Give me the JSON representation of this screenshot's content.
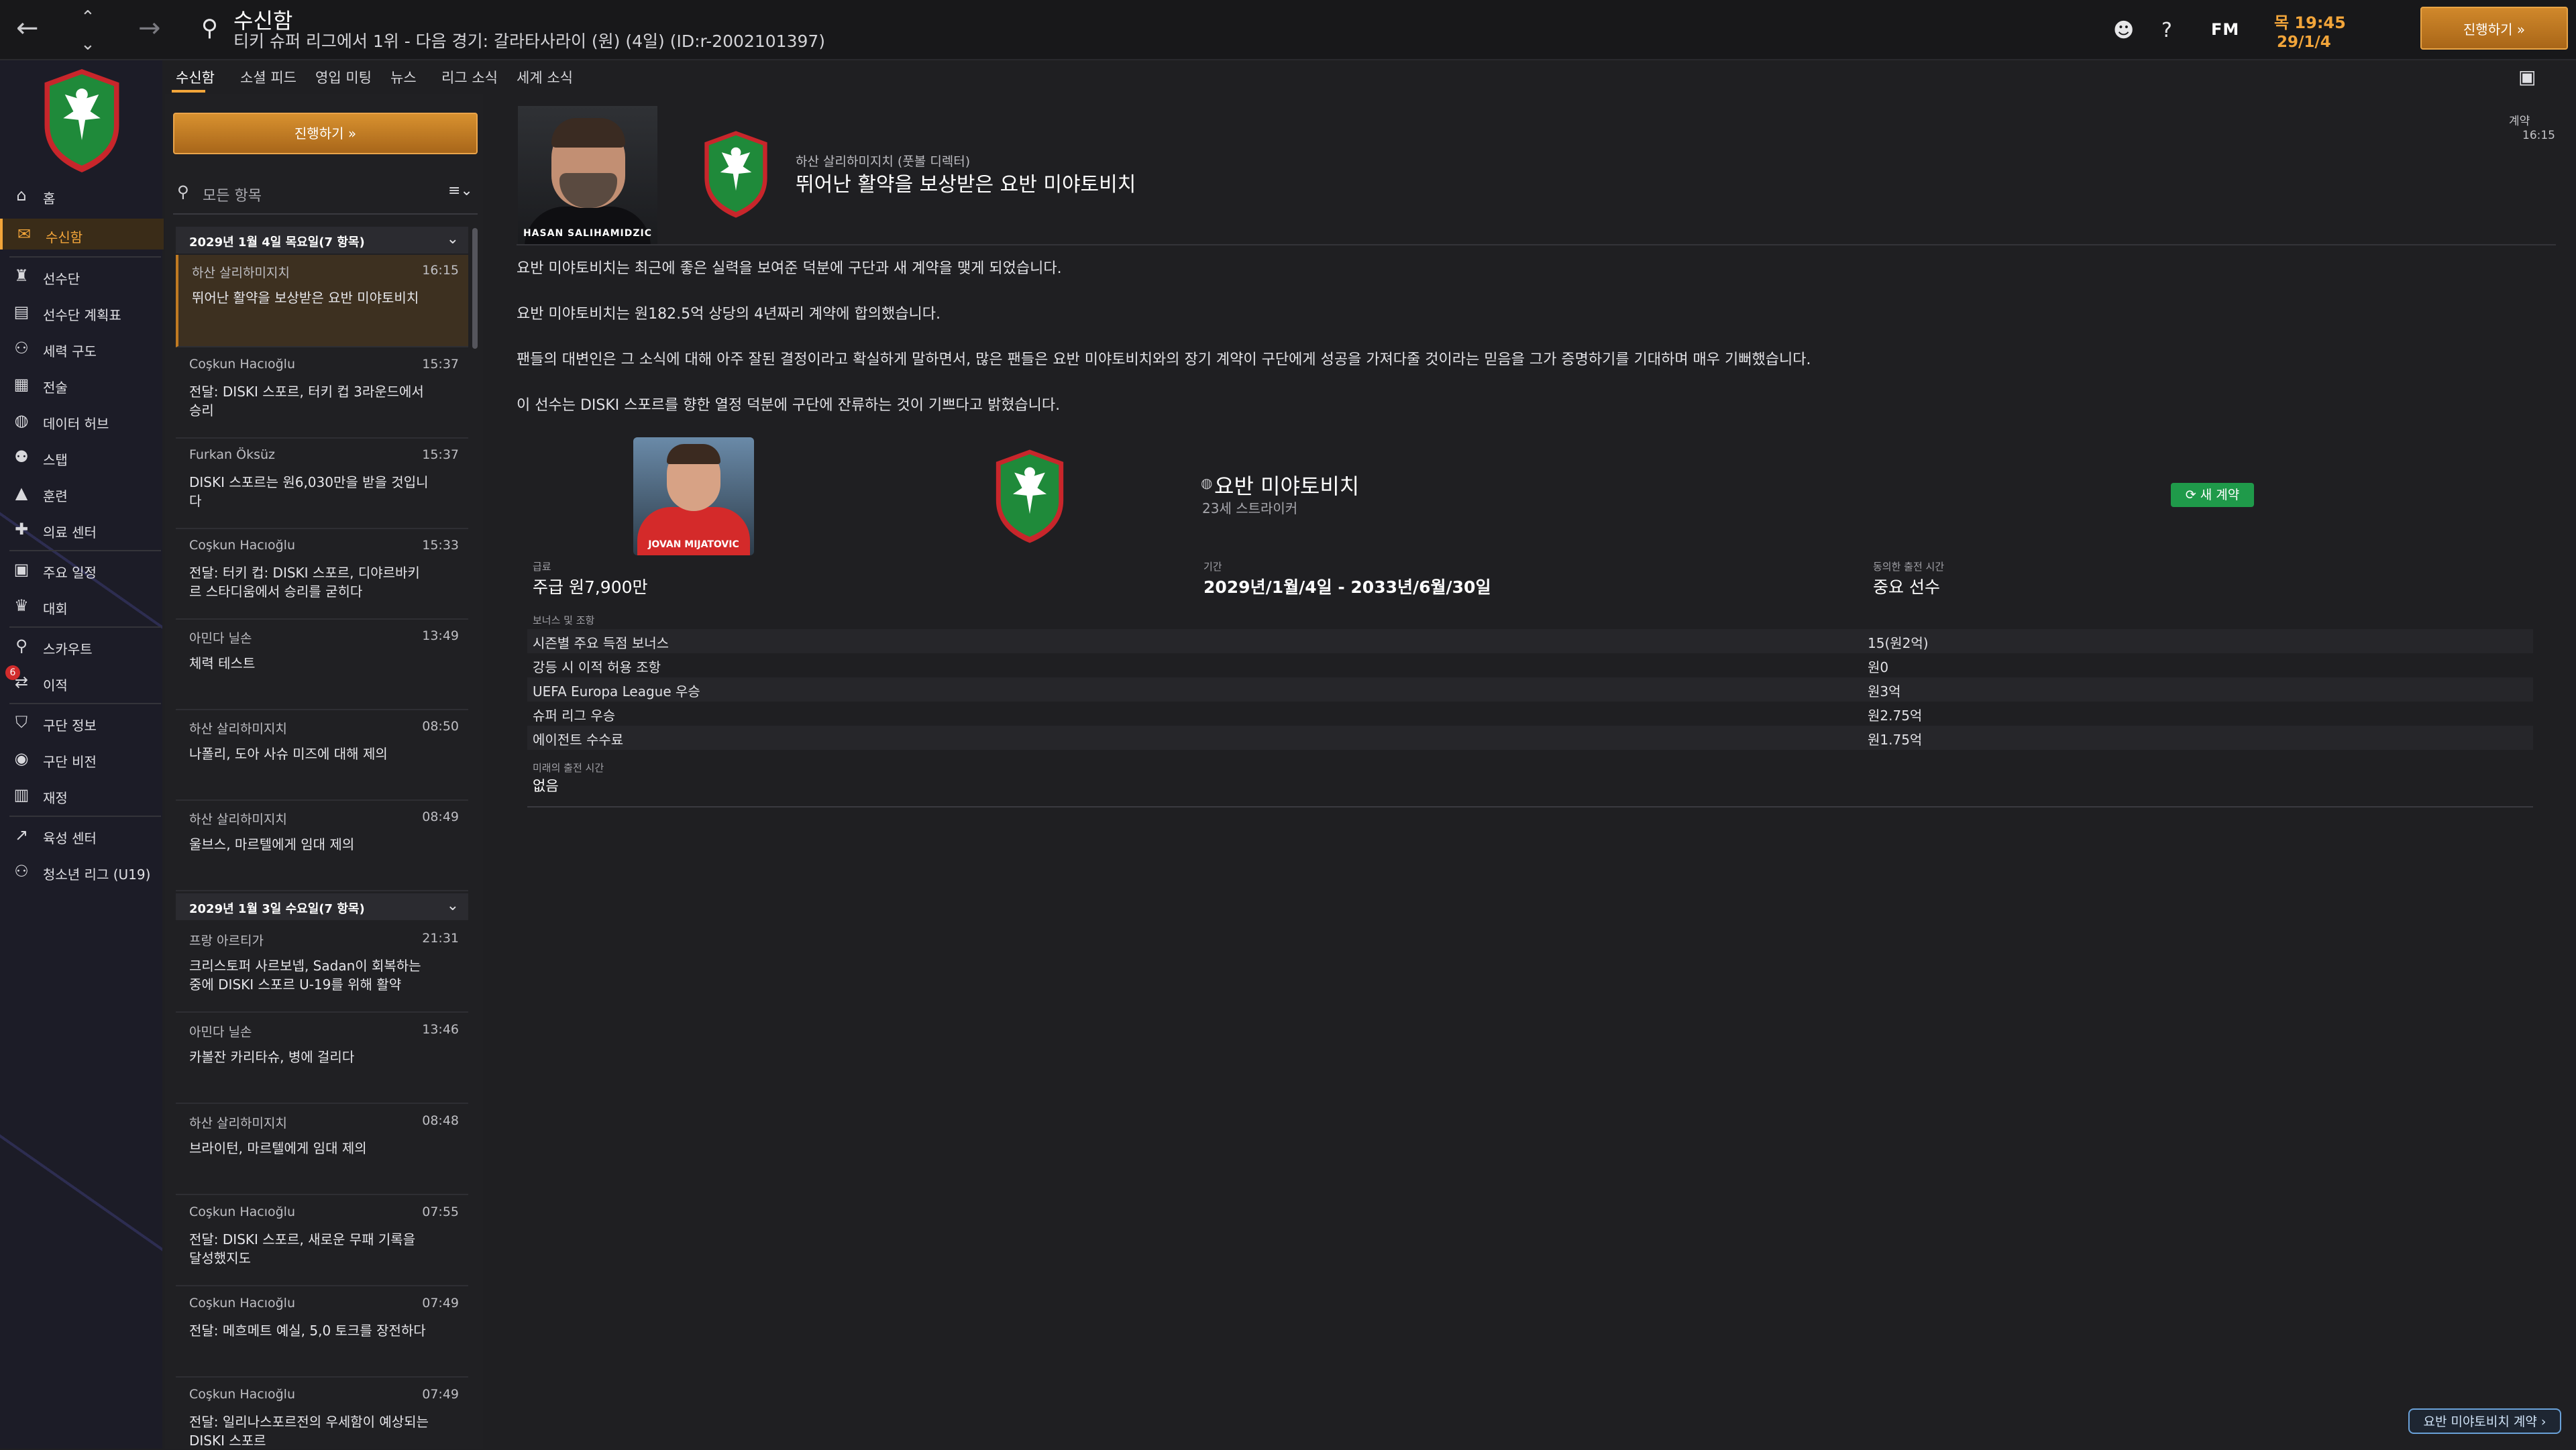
{
  "topbar": {
    "title": "수신함",
    "subtitle": "티키 슈퍼 리그에서 1위 - 다음 경기: 갈라타사라이 (원) (4일) (ID:r-2002101397)",
    "fm": "FM",
    "clock": "목 19:45",
    "date": "29/1/4",
    "continue": "진행하기 »"
  },
  "nav": {
    "items": [
      "홈",
      "수신함",
      "선수단",
      "선수단 계획표",
      "세력 구도",
      "전술",
      "데이터 허브",
      "스탭",
      "훈련",
      "의료 센터",
      "주요 일정",
      "대회",
      "스카우트",
      "이적",
      "구단 정보",
      "구단 비전",
      "재정",
      "육성 센터",
      "청소년 리그 (U19)"
    ],
    "transfer_badge": "6"
  },
  "subtabs": [
    "수신함",
    "소셜 피드",
    "영입 미팅",
    "뉴스",
    "리그 소식",
    "세계 소식"
  ],
  "list": {
    "continue": "진행하기 »",
    "filter_placeholder": "모든 항목",
    "day1": "2029년 1월 4일 목요일(7 항목)",
    "day2": "2029년 1월 3일 수요일(7 항목)",
    "messages_day1": [
      {
        "sender": "하산 살리하미지치",
        "time": "16:15",
        "subject": "뛰어난 활약을 보상받은 요반 미야토비치"
      },
      {
        "sender": "Coşkun Hacıoğlu",
        "time": "15:37",
        "subject": "전달: DISKI 스포르, 터키 컵 3라운드에서 승리"
      },
      {
        "sender": "Furkan Öksüz",
        "time": "15:37",
        "subject": "DISKI 스포르는 원6,030만을 받을 것입니다"
      },
      {
        "sender": "Coşkun Hacıoğlu",
        "time": "15:33",
        "subject": "전달: 터키 컵: DISKI 스포르, 디야르바키르 스타디움에서 승리를 굳히다"
      },
      {
        "sender": "아민다 닐손",
        "time": "13:49",
        "subject": "체력 테스트"
      },
      {
        "sender": "하산 살리하미지치",
        "time": "08:50",
        "subject": "나폴리, 도아 사슈 미즈에 대해 제의"
      },
      {
        "sender": "하산 살리하미지치",
        "time": "08:49",
        "subject": "울브스, 마르텔에게 임대 제의"
      }
    ],
    "messages_day2": [
      {
        "sender": "프랑 아르티가",
        "time": "21:31",
        "subject": "크리스토퍼 사르보넵, Sadan이 회복하는 중에 DISKI 스포르 U-19를 위해 활약"
      },
      {
        "sender": "아민다 닐손",
        "time": "13:46",
        "subject": "카볼잔 카리타슈, 병에 걸리다"
      },
      {
        "sender": "하산 살리하미지치",
        "time": "08:48",
        "subject": "브라이턴, 마르텔에게 임대 제의"
      },
      {
        "sender": "Coşkun Hacıoğlu",
        "time": "07:55",
        "subject": "전달: DISKI 스포르, 새로운 무패 기록을 달성했지도"
      },
      {
        "sender": "Coşkun Hacıoğlu",
        "time": "07:49",
        "subject": "전달: 메흐메트 예실, 5,0 토크를 장전하다"
      },
      {
        "sender": "Coşkun Hacıoğlu",
        "time": "07:49",
        "subject": "전달: 일리나스포르전의 우세함이 예상되는 DISKI 스포르"
      }
    ]
  },
  "message": {
    "manager_caption": "HASAN SALIHAMIDZIC",
    "from": "하산 살리하미지치 (풋볼 디렉터)",
    "title": "뛰어난 활약을 보상받은 요반 미야토비치",
    "tag": "계약",
    "tag_time": "16:15",
    "paragraphs": [
      "요반 미야토비치는 최근에 좋은 실력을 보여준 덕분에 구단과 새 계약을 맺게 되었습니다.",
      "요반 미야토비치는 원182.5억 상당의 4년짜리 계약에 합의했습니다.",
      "팬들의 대변인은 그 소식에 대해 아주 잘된 결정이라고 확실하게 말하면서, 많은 팬들은 요반 미야토비치와의 장기 계약이 구단에게 성공을 가져다줄 것이라는 믿음을 그가 증명하기를 기대하며 매우 기뻐했습니다.",
      "이 선수는 DISKI 스포르를 향한 열정 덕분에 구단에 잔류하는 것이 기쁘다고 밝혔습니다."
    ],
    "player_caption": "JOVAN MIJATOVIC",
    "player_name": "요반 미야토비치",
    "player_meta": "23세 스트라이커",
    "new_contract": "새 계약",
    "wage_label": "급료",
    "wage": "주급 원7,900만",
    "period_label": "기간",
    "period": "2029년/1월/4일 - 2033년/6월/30일",
    "playtime_label": "동의한 출전 시간",
    "playtime": "중요 선수",
    "bonus_label": "보너스 및 조항",
    "bonuses": [
      {
        "label": "시즌별 주요 득점 보너스",
        "value": "15(원2억)"
      },
      {
        "label": "강등 시 이적 허용 조항",
        "value": "원0"
      },
      {
        "label": "UEFA Europa League 우승",
        "value": "원3억"
      },
      {
        "label": "슈퍼 리그 우승",
        "value": "원2.75억"
      },
      {
        "label": "에이전트 수수료",
        "value": "원1.75억"
      }
    ],
    "future_label": "미래의 출전 시간",
    "future": "없음",
    "footer_button": "요반 미야토비치 계약 ›"
  },
  "colors": {
    "accent": "#f2a53a",
    "background": "#1f1f22",
    "success": "#1f9a4a",
    "danger": "#d22c2c"
  }
}
